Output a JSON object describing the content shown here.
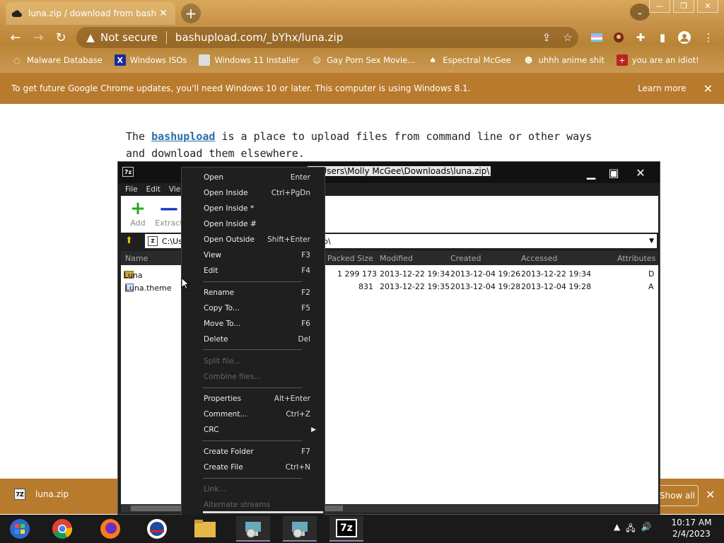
{
  "browser": {
    "tab_title": "luna.zip / download from bashuplo...",
    "tab_close": "✕",
    "new_tab": "+",
    "not_secure": "Not secure",
    "url": "bashupload.com/_bYhx/luna.zip",
    "win_minimize": "—",
    "win_restore": "❐",
    "win_close": "✕"
  },
  "bookmarks": [
    {
      "label": "Malware Database"
    },
    {
      "label": "Windows ISOs"
    },
    {
      "label": "Windows 11 Installer"
    },
    {
      "label": "Gay Porn Sex Movie..."
    },
    {
      "label": "Espectral McGee"
    },
    {
      "label": "uhhh anime shit"
    },
    {
      "label": "you are an idiot!"
    }
  ],
  "infobar": {
    "message": "To get future Google Chrome updates, you'll need Windows 10 or later. This computer is using Windows 8.1.",
    "learn_more": "Learn more",
    "close": "✕"
  },
  "page": {
    "text_before": "The ",
    "link": "bashupload",
    "text_after": " is a place to upload files from command line or other ways and download them elsewhere."
  },
  "download_shelf": {
    "file": "luna.zip",
    "show_all": "Show all",
    "close": "✕"
  },
  "sevenzip": {
    "logo": "7z",
    "title": "C:\\Users\\Molly McGee\\Downloads\\luna.zip\\",
    "menu": [
      "File",
      "Edit",
      "View"
    ],
    "toolbar": [
      {
        "label": "Add",
        "glyph": "+",
        "color": "#22aa22"
      },
      {
        "label": "Extract",
        "glyph": "—",
        "color": "#1030c0"
      }
    ],
    "address": "C:\\Us",
    "address_tail": "p\\",
    "columns": {
      "name": "Name",
      "packed": "Packed Size",
      "modified": "Modified",
      "created": "Created",
      "accessed": "Accessed",
      "attributes": "Attributes"
    },
    "rows": [
      {
        "name": "Luna",
        "packed": "1 299 173",
        "modified": "2013-12-22 19:34",
        "created": "2013-12-04 19:26",
        "accessed": "2013-12-22 19:34",
        "attr": "D"
      },
      {
        "name": "Luna.theme",
        "packed": "831",
        "modified": "2013-12-22 19:35",
        "created": "2013-12-04 19:28",
        "accessed": "2013-12-04 19:28",
        "attr": "A"
      }
    ]
  },
  "context_menu": [
    {
      "label": "Open",
      "shortcut": "Enter",
      "disabled": false
    },
    {
      "label": "Open Inside",
      "shortcut": "Ctrl+PgDn",
      "disabled": false
    },
    {
      "label": "Open Inside *",
      "shortcut": "",
      "disabled": false
    },
    {
      "label": "Open Inside #",
      "shortcut": "",
      "disabled": false
    },
    {
      "label": "Open Outside",
      "shortcut": "Shift+Enter",
      "disabled": false
    },
    {
      "label": "View",
      "shortcut": "F3",
      "disabled": false
    },
    {
      "label": "Edit",
      "shortcut": "F4",
      "disabled": false
    },
    {
      "label": "Rename",
      "shortcut": "F2",
      "disabled": false
    },
    {
      "label": "Copy To...",
      "shortcut": "F5",
      "disabled": false
    },
    {
      "label": "Move To...",
      "shortcut": "F6",
      "disabled": false
    },
    {
      "label": "Delete",
      "shortcut": "Del",
      "disabled": false
    },
    {
      "label": "Split file...",
      "shortcut": "",
      "disabled": true
    },
    {
      "label": "Combine files...",
      "shortcut": "",
      "disabled": true
    },
    {
      "label": "Properties",
      "shortcut": "Alt+Enter",
      "disabled": false
    },
    {
      "label": "Comment...",
      "shortcut": "Ctrl+Z",
      "disabled": false
    },
    {
      "label": "CRC",
      "shortcut": "",
      "disabled": false,
      "submenu": true
    },
    {
      "label": "Create Folder",
      "shortcut": "F7",
      "disabled": false
    },
    {
      "label": "Create File",
      "shortcut": "Ctrl+N",
      "disabled": false
    },
    {
      "label": "Link...",
      "shortcut": "",
      "disabled": true
    },
    {
      "label": "Alternate streams",
      "shortcut": "",
      "disabled": true
    }
  ],
  "taskbar": {
    "clock_time": "10:17 AM",
    "clock_date": "2/4/2023",
    "sevenzip_label": "7z"
  }
}
